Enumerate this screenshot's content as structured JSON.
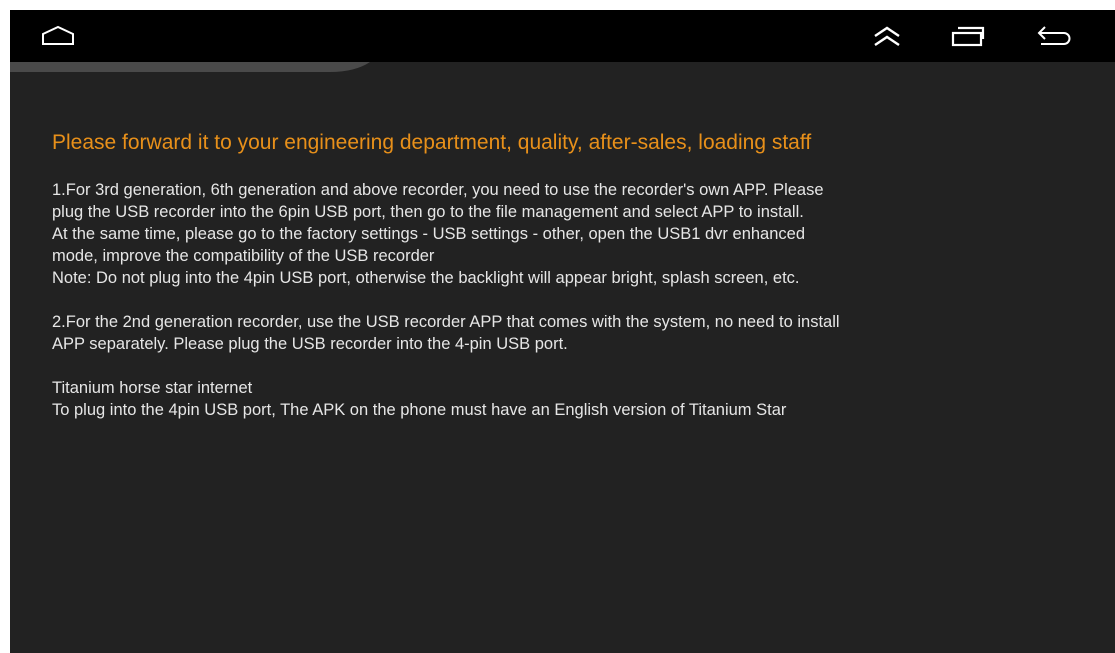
{
  "navbar": {
    "home_icon": "home-outline-icon",
    "up_icon": "double-chevron-up-icon",
    "recents_icon": "recent-apps-icon",
    "back_icon": "back-arrow-icon"
  },
  "notice": {
    "heading": "Please forward it to your engineering department, quality, after-sales, loading staff",
    "section1": [
      "1.For 3rd generation, 6th generation and above recorder, you need to use the recorder's own APP. Please",
      "plug the USB recorder into the 6pin USB port, then go to the file management and select APP to install.",
      "At the same time, please go to the factory settings - USB settings - other, open the USB1 dvr enhanced",
      "mode, improve the compatibility of the USB recorder",
      "Note: Do not plug into the 4pin USB port, otherwise the backlight will appear bright, splash screen, etc."
    ],
    "section2": [
      "2.For the 2nd generation recorder, use the USB recorder APP that comes with the system, no need to install",
      "APP separately. Please plug the USB recorder into the 4-pin USB port."
    ],
    "section3": [
      "Titanium horse star internet",
      "To plug into the 4pin USB port, The APK on the phone must have an English version of Titanium Star"
    ]
  },
  "colors": {
    "heading": "#e8901a",
    "text": "#e6e6e6",
    "background": "#222222",
    "navbar": "#000000"
  }
}
